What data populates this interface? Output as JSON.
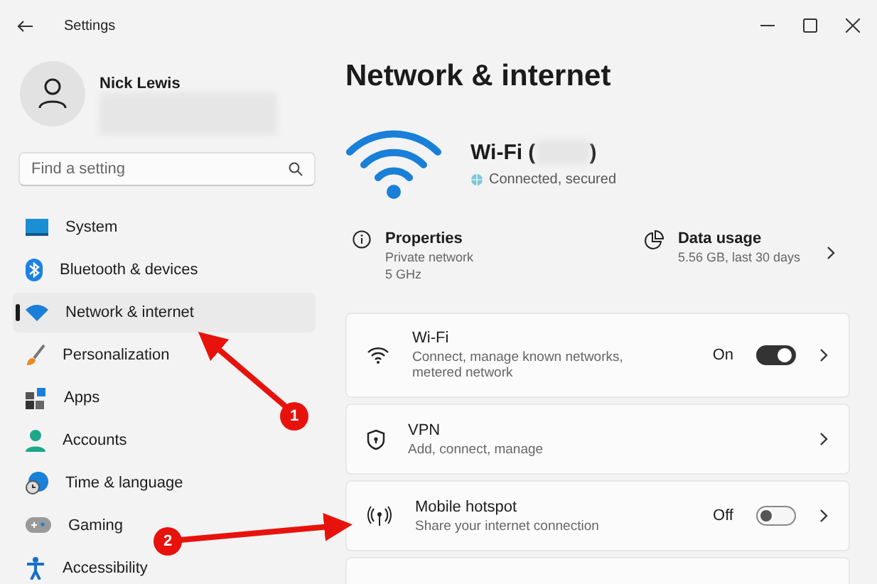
{
  "window": {
    "title": "Settings"
  },
  "user": {
    "name": "Nick Lewis"
  },
  "search": {
    "placeholder": "Find a setting"
  },
  "sidebar": {
    "items": [
      {
        "label": "System",
        "selected": false
      },
      {
        "label": "Bluetooth & devices",
        "selected": false
      },
      {
        "label": "Network & internet",
        "selected": true
      },
      {
        "label": "Personalization",
        "selected": false
      },
      {
        "label": "Apps",
        "selected": false
      },
      {
        "label": "Accounts",
        "selected": false
      },
      {
        "label": "Time & language",
        "selected": false
      },
      {
        "label": "Gaming",
        "selected": false
      },
      {
        "label": "Accessibility",
        "selected": false
      }
    ]
  },
  "page": {
    "title": "Network & internet"
  },
  "connection": {
    "name_start": "Wi-Fi (",
    "name_end": ")",
    "status": "Connected, secured"
  },
  "properties": {
    "title": "Properties",
    "lines": [
      "Private network",
      "5 GHz"
    ]
  },
  "data_usage": {
    "title": "Data usage",
    "detail": "5.56 GB, last 30 days"
  },
  "settings": [
    {
      "kind": "toggle",
      "title": "Wi-Fi",
      "subtitle": "Connect, manage known networks, metered network",
      "state_label": "On",
      "on": true
    },
    {
      "kind": "link",
      "title": "VPN",
      "subtitle": "Add, connect, manage"
    },
    {
      "kind": "toggle",
      "title": "Mobile hotspot",
      "subtitle": "Share your internet connection",
      "state_label": "Off",
      "on": false
    }
  ],
  "annotations": [
    {
      "label": "1"
    },
    {
      "label": "2"
    }
  ]
}
